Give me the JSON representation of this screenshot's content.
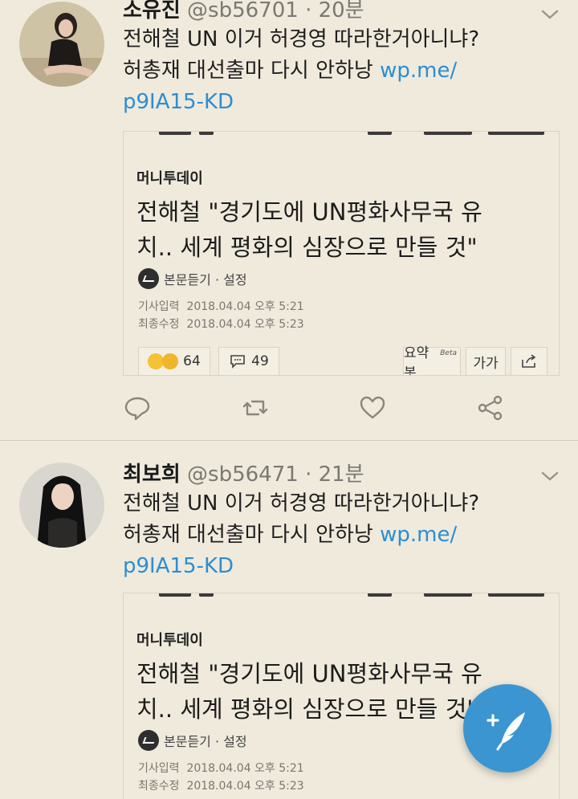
{
  "tweets": [
    {
      "name": "소유진",
      "handle": "@sb56701",
      "separator": "·",
      "time": "20분",
      "text_line1": "전해철 UN 이거 허경영 따라한거아니냐?",
      "text_line2": "허총재 대선출마 다시 안하낭",
      "link_part1": "wp.me/",
      "link_part2": "p9IA15-KD",
      "card": {
        "source": "머니투데이",
        "headline_line1": "전해철 \"경기도에 UN평화사무국 유",
        "headline_line2": "치.. 세계 평화의 심장으로 만들 것\"",
        "listen_label": "본문듣기 · 설정",
        "input_label": "기사입력",
        "input_time": "2018.04.04 오후 5:21",
        "edit_label": "최종수정",
        "edit_time": "2018.04.04 오후 5:23",
        "reactions_count": "64",
        "comments_count": "49",
        "summary_label": "요약봇",
        "summary_badge": "Beta",
        "font_size_label": "가가"
      }
    },
    {
      "name": "최보희",
      "handle": "@sb56471",
      "separator": "·",
      "time": "21분",
      "text_line1": "전해철 UN 이거 허경영 따라한거아니냐?",
      "text_line2": "허총재 대선출마 다시 안하낭",
      "link_part1": "wp.me/",
      "link_part2": "p9IA15-KD",
      "card": {
        "source": "머니투데이",
        "headline_line1": "전해철 \"경기도에 UN평화사무국 유",
        "headline_line2": "치.. 세계 평화의 심장으로 만들 것\"",
        "listen_label": "본문듣기 · 설정",
        "input_label": "기사입력",
        "input_time": "2018.04.04 오후 5:21",
        "edit_label": "최종수정",
        "edit_time": "2018.04.04 오후 5:23"
      }
    }
  ],
  "icons": {
    "reply": "reply-icon",
    "retweet": "retweet-icon",
    "like": "heart-icon",
    "share": "share-icon",
    "compose": "compose-quill-icon",
    "more": "chevron-down-icon"
  },
  "colors": {
    "background": "#efeadc",
    "link": "#2b8ed3",
    "fab": "#3b95d1",
    "muted": "#7b7870"
  }
}
